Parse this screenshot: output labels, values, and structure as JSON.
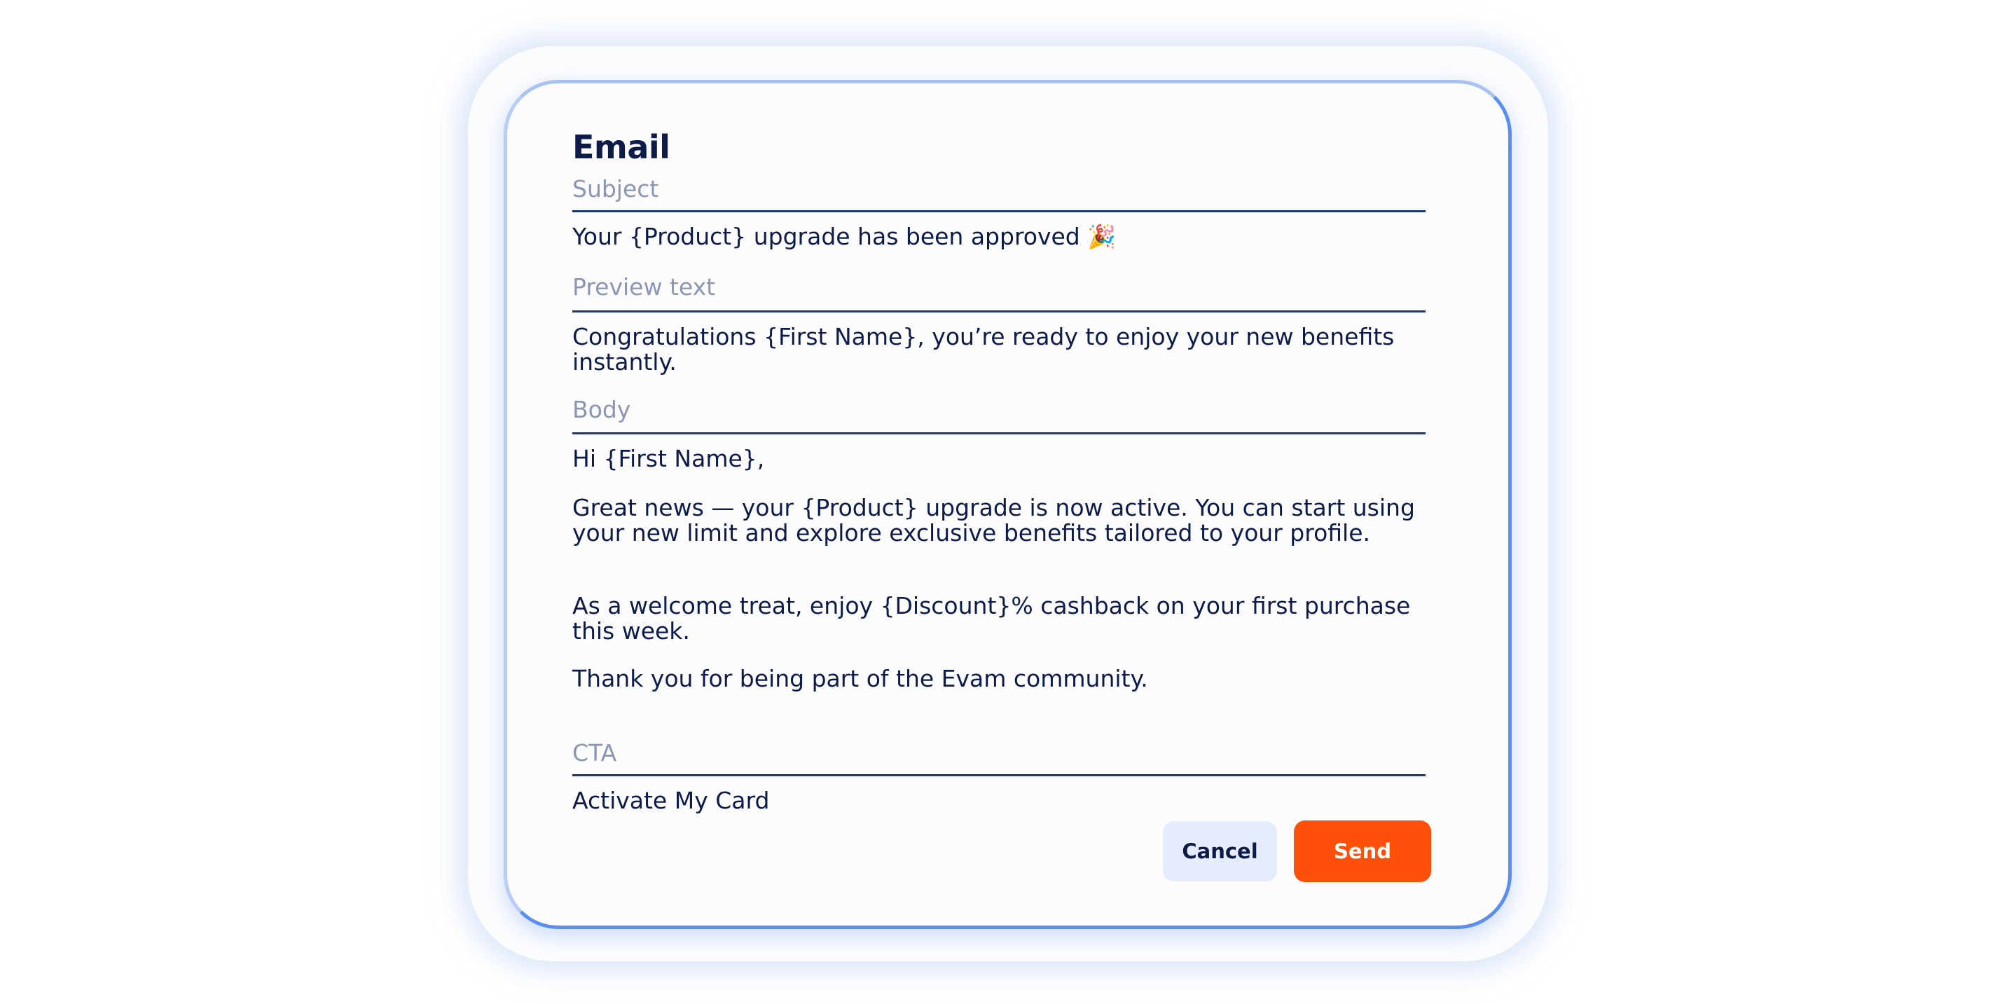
{
  "form": {
    "title": "Email",
    "subject": {
      "label": "Subject",
      "value": "Your {Product} upgrade has been approved 🎉"
    },
    "preview_text": {
      "label": "Preview text",
      "value": "Congratulations {First Name}, you’re ready to enjoy your new benefits instantly."
    },
    "body": {
      "label": "Body",
      "paragraphs": [
        "Hi {First Name},",
        "Great news — your {Product} upgrade is now active. You can start using your new limit and explore exclusive benefits tailored to your profile.",
        "As a welcome treat, enjoy {Discount}% cashback on your first purchase this week.",
        "Thank you for being part of the Evam community."
      ]
    },
    "cta": {
      "label": "CTA",
      "value": "Activate My Card"
    }
  },
  "actions": {
    "cancel_label": "Cancel",
    "send_label": "Send"
  },
  "colors": {
    "accent": "#ff4f08",
    "text": "#0c1b48",
    "label": "#8a96b3",
    "border": "#5a8ef0"
  }
}
